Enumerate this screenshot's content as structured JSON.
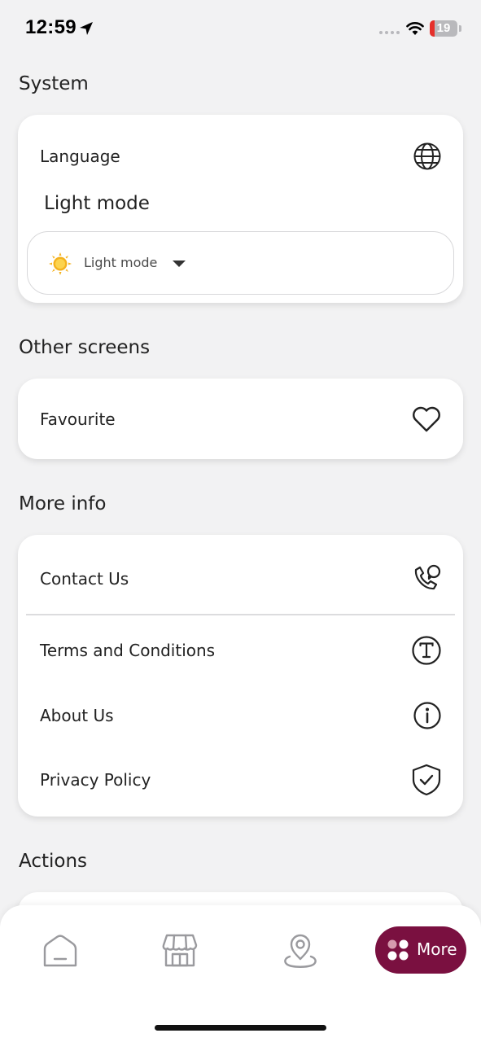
{
  "status_bar": {
    "time": "12:59",
    "battery": "19"
  },
  "system": {
    "title": "System",
    "language_label": "Language",
    "theme_heading": "Light mode",
    "theme_select_value": "Light mode"
  },
  "other_screens": {
    "title": "Other screens",
    "favourite_label": "Favourite"
  },
  "more_info": {
    "title": "More info",
    "items": [
      {
        "label": "Contact Us",
        "icon": "phone-chat-icon"
      },
      {
        "label": "Terms and Conditions",
        "icon": "terms-t-icon"
      },
      {
        "label": "About Us",
        "icon": "info-icon"
      },
      {
        "label": "Privacy Policy",
        "icon": "shield-check-icon"
      }
    ]
  },
  "actions": {
    "title": "Actions"
  },
  "nav": {
    "items": [
      {
        "name": "home",
        "icon": "home-icon"
      },
      {
        "name": "store",
        "icon": "store-icon"
      },
      {
        "name": "location",
        "icon": "location-pin-icon"
      }
    ],
    "more_label": "More",
    "accent": "#7a1040"
  }
}
